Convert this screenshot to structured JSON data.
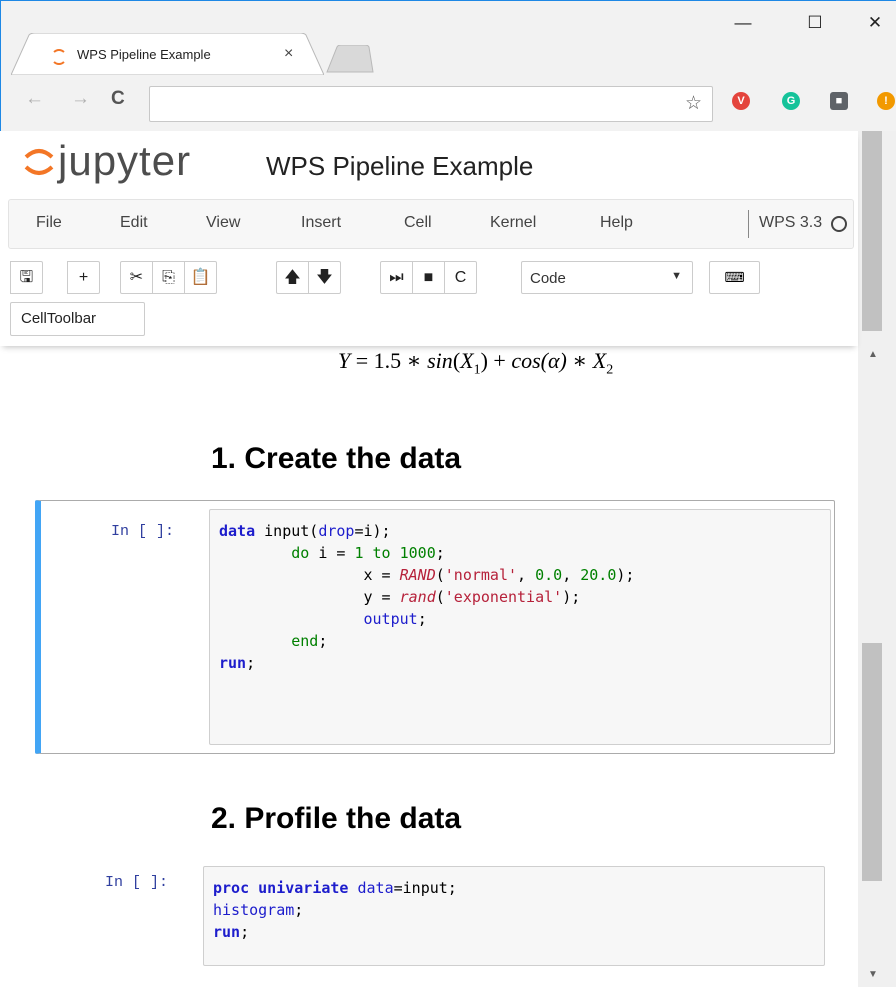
{
  "browser": {
    "tab_title": "WPS Pipeline Example",
    "tab_close": "×",
    "window_controls": {
      "minimize": "—",
      "maximize": "☐",
      "close": "✕"
    },
    "nav": {
      "back": "←",
      "forward": "→",
      "reload": "C"
    },
    "address_value": "",
    "star": "☆",
    "extensions": [
      {
        "name": "vivaldi-ext-icon",
        "color": "#e4443c",
        "glyph": "V"
      },
      {
        "name": "grammarly-ext-icon",
        "color": "#15c39a",
        "glyph": "G"
      },
      {
        "name": "ext-square-icon",
        "color": "#5f6368",
        "glyph": "■"
      },
      {
        "name": "ext-alert-icon",
        "color": "#f29900",
        "glyph": "!"
      }
    ]
  },
  "jupyter": {
    "logo_text": "jupyter",
    "notebook_title": "WPS Pipeline Example",
    "menu": [
      "File",
      "Edit",
      "View",
      "Insert",
      "Cell",
      "Kernel",
      "Help"
    ],
    "kernel_name": "WPS 3.3",
    "toolbar": {
      "save": "🖫",
      "add": "+",
      "cut": "✂",
      "copy": "⎘",
      "paste": "📋",
      "up": "🡅",
      "down": "🡇",
      "run": "⏭",
      "stop": "■",
      "restart": "C",
      "cell_type": "Code",
      "cell_type_caret": "▼",
      "keyboard": "⌨",
      "celltoolbar": "CellToolbar"
    }
  },
  "notebook": {
    "equation": {
      "lhs": "Y",
      "eq": " = 1.5 ∗ ",
      "sin": "sin",
      "x1": "X",
      "x1_sub": "1",
      "mid": ") + ",
      "cos": "cos",
      "alpha": "(α) ∗ X",
      "x2_sub": "2"
    },
    "headings": [
      "1. Create the data",
      "2. Profile the data"
    ],
    "cells": [
      {
        "prompt": "In [ ]:"
      },
      {
        "prompt": "In [ ]:"
      }
    ]
  },
  "colors": {
    "accent": "#42a5f5",
    "prompt": "#303f9f",
    "browser_border": "#1e88e5"
  }
}
